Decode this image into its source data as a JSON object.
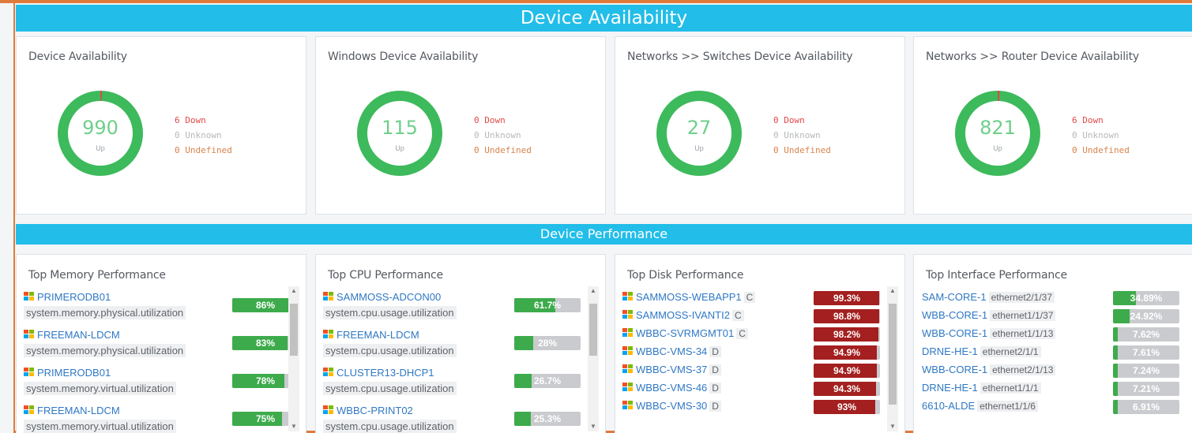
{
  "header": {
    "title": "Device Availability"
  },
  "section2": {
    "title": "Device Performance"
  },
  "availability": [
    {
      "title": "Device Availability",
      "count": "990",
      "up_label": "Up",
      "down": "6 Down",
      "unknown": "0 Unknown",
      "undefined": "0 Undefined",
      "down_fraction": 0.006
    },
    {
      "title": "Windows Device Availability",
      "count": "115",
      "up_label": "Up",
      "down": "0 Down",
      "unknown": "0 Unknown",
      "undefined": "0 Undefined",
      "down_fraction": 0
    },
    {
      "title": "Networks >> Switches Device Availability",
      "count": "27",
      "up_label": "Up",
      "down": "0 Down",
      "unknown": "0 Unknown",
      "undefined": "0 Undefined",
      "down_fraction": 0
    },
    {
      "title": "Networks >> Router Device Availability",
      "count": "821",
      "up_label": "Up",
      "down": "6 Down",
      "unknown": "0 Unknown",
      "undefined": "0 Undefined",
      "down_fraction": 0.007
    }
  ],
  "memory": {
    "title": "Top Memory Performance",
    "rows": [
      {
        "device": "PRIMERODB01",
        "metric": "system.memory.physical.utilization",
        "value": "86%",
        "pct": 86
      },
      {
        "device": "FREEMAN-LDCM",
        "metric": "system.memory.physical.utilization",
        "value": "83%",
        "pct": 83
      },
      {
        "device": "PRIMERODB01",
        "metric": "system.memory.virtual.utilization",
        "value": "78%",
        "pct": 78
      },
      {
        "device": "FREEMAN-LDCM",
        "metric": "system.memory.virtual.utilization",
        "value": "75%",
        "pct": 75
      }
    ]
  },
  "cpu": {
    "title": "Top CPU Performance",
    "rows": [
      {
        "device": "SAMMOSS-ADCON00",
        "metric": "system.cpu.usage.utilization",
        "value": "61.7%",
        "pct": 61.7
      },
      {
        "device": "FREEMAN-LDCM",
        "metric": "system.cpu.usage.utilization",
        "value": "28%",
        "pct": 28
      },
      {
        "device": "CLUSTER13-DHCP1",
        "metric": "system.cpu.usage.utilization",
        "value": "26.7%",
        "pct": 26.7
      },
      {
        "device": "WBBC-PRINT02",
        "metric": "system.cpu.usage.utilization",
        "value": "25.3%",
        "pct": 25.3
      }
    ]
  },
  "disk": {
    "title": "Top Disk Performance",
    "rows": [
      {
        "device": "SAMMOSS-WEBAPP1",
        "drive": "C",
        "value": "99.3%",
        "pct": 99.3
      },
      {
        "device": "SAMMOSS-IVANTI2",
        "drive": "C",
        "value": "98.8%",
        "pct": 98.8
      },
      {
        "device": "WBBC-SVRMGMT01",
        "drive": "C",
        "value": "98.2%",
        "pct": 98.2
      },
      {
        "device": "WBBC-VMS-34",
        "drive": "D",
        "value": "94.9%",
        "pct": 94.9
      },
      {
        "device": "WBBC-VMS-37",
        "drive": "D",
        "value": "94.9%",
        "pct": 94.9
      },
      {
        "device": "WBBC-VMS-46",
        "drive": "D",
        "value": "94.3%",
        "pct": 94.3
      },
      {
        "device": "WBBC-VMS-30",
        "drive": "D",
        "value": "93%",
        "pct": 93
      }
    ]
  },
  "interface": {
    "title": "Top Interface Performance",
    "rows": [
      {
        "device": "SAM-CORE-1",
        "port": "ethernet2/1/37",
        "value": "34.89%",
        "pct": 34.89
      },
      {
        "device": "WBB-CORE-1",
        "port": "ethernet1/1/37",
        "value": "24.92%",
        "pct": 24.92
      },
      {
        "device": "WBB-CORE-1",
        "port": "ethernet1/1/13",
        "value": "7.62%",
        "pct": 7.62
      },
      {
        "device": "DRNE-HE-1",
        "port": "ethernet2/1/1",
        "value": "7.61%",
        "pct": 7.61
      },
      {
        "device": "WBB-CORE-1",
        "port": "ethernet2/1/13",
        "value": "7.24%",
        "pct": 7.24
      },
      {
        "device": "DRNE-HE-1",
        "port": "ethernet1/1/1",
        "value": "7.21%",
        "pct": 7.21
      },
      {
        "device": "6610-ALDE",
        "port": "ethernet1/1/6",
        "value": "6.91%",
        "pct": 6.91
      }
    ]
  },
  "colors": {
    "banner": "#22bde9",
    "up": "#3dba5c",
    "down": "#e04848",
    "bar_green": "#3dab4b",
    "bar_red": "#a41f1f"
  }
}
